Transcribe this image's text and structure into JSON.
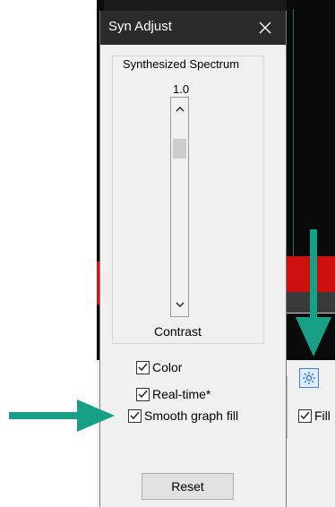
{
  "dialog": {
    "title": "Syn Adjust",
    "close_icon": "close-icon",
    "group_label": "Synthesized Spectrum",
    "slider": {
      "value_label": "1.0",
      "caption": "Contrast",
      "level": 0.82
    },
    "checkboxes": [
      {
        "label": "Color",
        "checked": true
      },
      {
        "label": "Real-time*",
        "checked": true
      },
      {
        "label": "Smooth graph fill",
        "checked": true
      }
    ],
    "reset_label": "Reset"
  },
  "right_panel": {
    "settings_icon": "gear-icon",
    "fill_label": "Fill",
    "fill_checked": true
  },
  "annotations": {
    "arrow_color": "#16a085"
  },
  "colors": {
    "titlebar": "#2b2b2b",
    "dialog_bg": "#f0f0f0",
    "accent": "#3c7fd8"
  }
}
